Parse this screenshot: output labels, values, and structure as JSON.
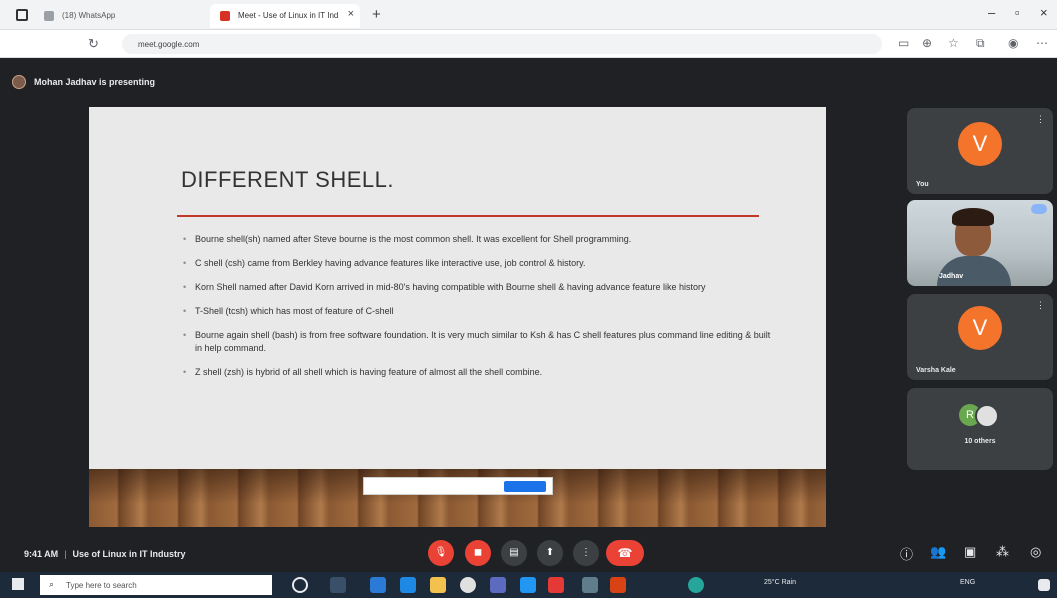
{
  "browser": {
    "tabs": [
      {
        "label": "(18) WhatsApp",
        "active": false
      },
      {
        "label": "Meet - Use of Linux in IT Ind",
        "active": true
      }
    ],
    "url": "meet.google.com",
    "new_tab_icon": "plus-icon"
  },
  "meet": {
    "presenting_text": "Mohan Jadhav is presenting",
    "slide": {
      "title": "DIFFERENT SHELL.",
      "bullets": [
        "Bourne shell(sh) named after Steve bourne is the most common shell. It was excellent for Shell programming.",
        "C shell (csh) came from Berkley having advance features like interactive use, job control & history.",
        "Korn Shell named after David Korn arrived in mid-80's having compatible with Bourne shell & having advance feature like history",
        "T-Shell (tcsh) which has most of feature of C-shell",
        "Bourne again shell (bash) is from free software foundation. It is very much similar to Ksh & has C shell features plus command line editing & built in help command.",
        "Z shell (zsh) is hybrid of all shell which is having feature of almost all the shell combine."
      ]
    },
    "participants": [
      {
        "name": "You",
        "initial": "V",
        "type": "avatar"
      },
      {
        "name": "Jadhav",
        "type": "video"
      },
      {
        "name": "Varsha Kale",
        "initial": "V",
        "type": "avatar"
      },
      {
        "name": "10 others",
        "initial": "R",
        "type": "group"
      }
    ],
    "footer": {
      "time": "9:41 AM",
      "meeting_name": "Use of Linux in IT Industry"
    }
  },
  "taskbar": {
    "search_placeholder": "Type here to search",
    "weather": "25°C Rain",
    "lang": "ENG"
  },
  "colors": {
    "accent_red": "#ea4335",
    "avatar_orange": "#f4742b",
    "slide_rule": "#c0392b"
  }
}
